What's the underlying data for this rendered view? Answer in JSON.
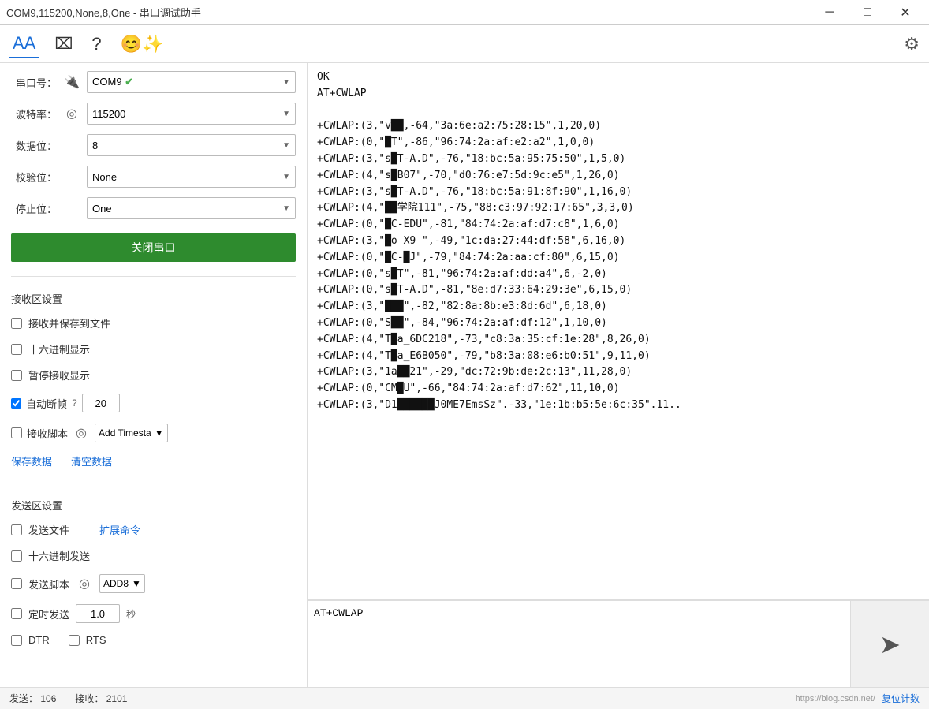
{
  "window": {
    "title": "COM9,115200,None,8,One - 串口调试助手",
    "min_label": "─",
    "max_label": "□",
    "close_label": "✕"
  },
  "toolbar": {
    "font_icon": "AA",
    "crop_icon": "⌧",
    "help_icon": "?",
    "emoji_icon": "😊",
    "settings_icon": "⚙"
  },
  "left_panel": {
    "port_label": "串口号：",
    "port_icon": "🔌",
    "port_value": "COM9",
    "port_check": "✔",
    "baud_label": "波特率：",
    "baud_icon": "⏱",
    "baud_value": "115200",
    "data_label": "数据位：",
    "data_value": "8",
    "parity_label": "校验位：",
    "parity_value": "None",
    "stop_label": "停止位：",
    "stop_value": "One",
    "close_btn": "关闭串口",
    "receive_settings_title": "接收区设置",
    "save_to_file_label": "接收并保存到文件",
    "hex_display_label": "十六进制显示",
    "pause_display_label": "暂停接收显示",
    "auto_frame_label": "自动断帧",
    "auto_frame_value": "20",
    "receive_script_label": "接收脚本",
    "receive_script_option": "Add Timesta",
    "save_data_link": "保存数据",
    "clear_data_link": "清空数据",
    "send_settings_title": "发送区设置",
    "send_file_label": "发送文件",
    "expand_cmd_link": "扩展命令",
    "hex_send_label": "十六进制发送",
    "send_script_label": "发送脚本",
    "send_script_option": "ADD8",
    "timed_send_label": "定时发送",
    "timed_send_value": "1.0",
    "timed_send_unit": "秒",
    "dtr_label": "DTR",
    "rts_label": "RTS"
  },
  "receive_area": {
    "content": "OK\nAT+CWLAP\n\n+CWLAP:(3,\"v██,-64,\"3a:6e:a2:75:28:15\",1,20,0)\n+CWLAP:(0,\"█T\",-86,\"96:74:2a:af:e2:a2\",1,0,0)\n+CWLAP:(3,\"s█T-A.D\",-76,\"18:bc:5a:95:75:50\",1,5,0)\n+CWLAP:(4,\"s█B07\",-70,\"d0:76:e7:5d:9c:e5\",1,26,0)\n+CWLAP:(3,\"s█T-A.D\",-76,\"18:bc:5a:91:8f:90\",1,16,0)\n+CWLAP:(4,\"██学院111\",-75,\"88:c3:97:92:17:65\",3,3,0)\n+CWLAP:(0,\"█C-EDU\",-81,\"84:74:2a:af:d7:c8\",1,6,0)\n+CWLAP:(3,\"█o X9 \",-49,\"1c:da:27:44:df:58\",6,16,0)\n+CWLAP:(0,\"█C-█J\",-79,\"84:74:2a:aa:cf:80\",6,15,0)\n+CWLAP:(0,\"s█T\",-81,\"96:74:2a:af:dd:a4\",6,-2,0)\n+CWLAP:(0,\"s█T-A.D\",-81,\"8e:d7:33:64:29:3e\",6,15,0)\n+CWLAP:(3,\"███\",-82,\"82:8a:8b:e3:8d:6d\",6,18,0)\n+CWLAP:(0,\"S██\",-84,\"96:74:2a:af:df:12\",1,10,0)\n+CWLAP:(4,\"T█a_6DC218\",-73,\"c8:3a:35:cf:1e:28\",8,26,0)\n+CWLAP:(4,\"T█a_E6B050\",-79,\"b8:3a:08:e6:b0:51\",9,11,0)\n+CWLAP:(3,\"1a█21\",-29,\"dc:72:9b:de:2c:13\",11,28,0)\n+CWLAP:(0,\"CM█U\",-66,\"84:74:2a:af:d7:62\",11,10,0)\n+CWLAP:(3,\"D1██████J0ME7EmsSz\".-33,\"1e:1b:b5:5e:6c:35\".11.."
  },
  "send_area": {
    "value": "AT+CWLAP"
  },
  "status_bar": {
    "send_label": "发送：",
    "send_count": "106",
    "receive_label": "接收：",
    "receive_count": "2101",
    "csdn_text": "https://blog.csdn.net/",
    "reset_link": "复位计数"
  }
}
